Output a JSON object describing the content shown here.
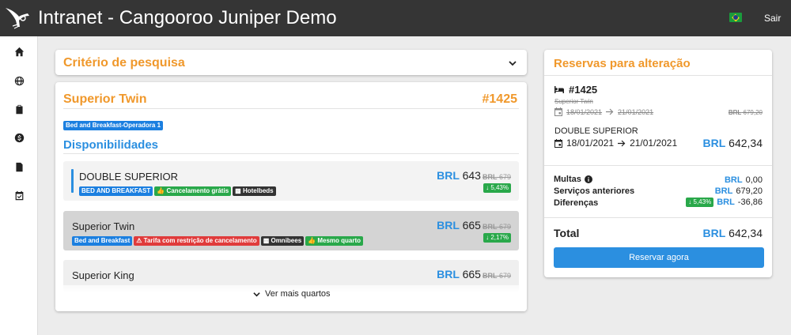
{
  "header": {
    "title": "Intranet - Cangooroo Juniper Demo",
    "logout_label": "Sair",
    "flag_icon": "brazil-flag-icon"
  },
  "sidebar": {
    "items": [
      {
        "icon": "home-icon"
      },
      {
        "icon": "globe-icon"
      },
      {
        "icon": "clipboard-icon"
      },
      {
        "icon": "dollar-icon"
      },
      {
        "icon": "document-icon"
      },
      {
        "icon": "calendar-check-icon"
      }
    ]
  },
  "criteria": {
    "title": "Critério de pesquisa"
  },
  "room": {
    "title": "Superior Twin",
    "code": "#1425",
    "tag": "Bed and Breakfast-Operadora 1"
  },
  "availability": {
    "title": "Disponibilidades",
    "options": [
      {
        "name": "DOUBLE SUPERIOR",
        "tags": [
          "BED AND BREAKFAST",
          "Cancelamento grátis",
          "Hotelbeds"
        ],
        "currency": "BRL",
        "price": "643",
        "old_currency": "BRL",
        "old_price": "679",
        "discount": "5,43%"
      },
      {
        "name": "Superior Twin",
        "tags": [
          "Bed and Breakfast",
          "Tarifa com restrição de cancelamento",
          "Omnibees",
          "Mesmo quarto"
        ],
        "currency": "BRL",
        "price": "665",
        "old_currency": "BRL",
        "old_price": "679",
        "discount": "2,17%"
      },
      {
        "name": "Superior King",
        "currency": "BRL",
        "price": "665",
        "old_currency": "BRL",
        "old_price": "679"
      }
    ],
    "more_label": "Ver mais quartos"
  },
  "reservation": {
    "title": "Reservas para alteração",
    "code": "#1425",
    "old_room": "Superior Twin",
    "old_checkin": "18/01/2021",
    "old_checkout": "21/01/2021",
    "old_price_currency": "BRL",
    "old_price": "679,20",
    "new_room": "DOUBLE SUPERIOR",
    "new_checkin": "18/01/2021",
    "new_checkout": "21/01/2021",
    "new_price_currency": "BRL",
    "new_price": "642,34",
    "summary": {
      "fines_label": "Multas",
      "fines_currency": "BRL",
      "fines_value": "0,00",
      "previous_label": "Serviços anteriores",
      "previous_currency": "BRL",
      "previous_value": "679,20",
      "diff_label": "Diferenças",
      "diff_pct": "5,43%",
      "diff_currency": "BRL",
      "diff_value": "-36,86"
    },
    "total_label": "Total",
    "total_currency": "BRL",
    "total_value": "642,34",
    "book_button": "Reservar agora"
  },
  "colors": {
    "accent_orange": "#f0982b",
    "accent_blue": "#2b8fe0",
    "success_green": "#29a84a",
    "danger_red": "#e03b3b",
    "header_bg": "#353535"
  }
}
